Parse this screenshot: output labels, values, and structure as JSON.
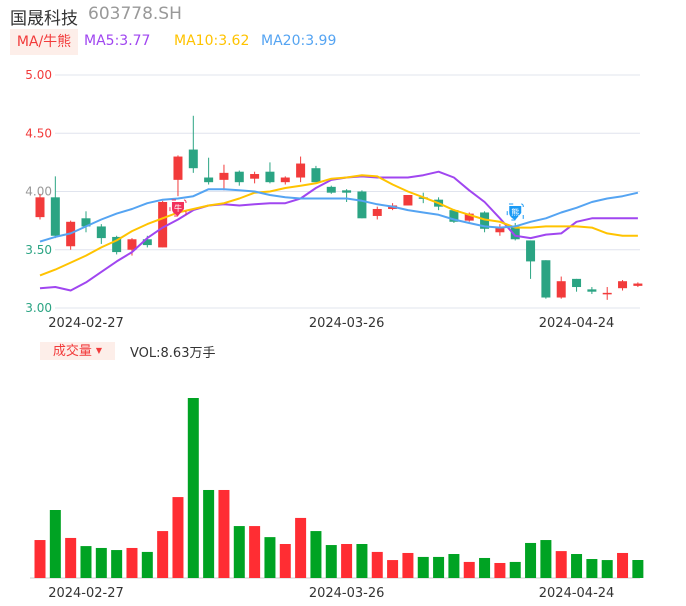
{
  "header": {
    "name": "国晟科技",
    "code": "603778.SH"
  },
  "ma_legend": {
    "tag": "MA/牛熊",
    "ma5": "MA5:3.77",
    "ma10": "MA10:3.62",
    "ma20": "MA20:3.99"
  },
  "volume_legend": {
    "tag": "成交量",
    "arrow": "▼",
    "value": "VOL:8.63万手"
  },
  "markers": {
    "bull": "牛",
    "bear": "熊"
  },
  "colors": {
    "up": "#f23b3b",
    "down": "#2ba483",
    "vol_up": "#ff2d33",
    "vol_down": "#00a323",
    "ma5": "#a046f0",
    "ma10": "#ffc300",
    "ma20": "#55a4f2"
  },
  "chart_data": [
    {
      "type": "candlestick",
      "title": "国晟科技 603778.SH",
      "yticks": [
        "5.00",
        "4.50",
        "4.00",
        "3.50",
        "3.00"
      ],
      "ylim": [
        3.0,
        5.0
      ],
      "xlabels": [
        {
          "index": 3,
          "label": "2024-02-27"
        },
        {
          "index": 20,
          "label": "2024-03-26"
        },
        {
          "index": 35,
          "label": "2024-04-24"
        }
      ],
      "ohlc": [
        [
          3.78,
          3.98,
          3.76,
          3.95
        ],
        [
          3.95,
          4.13,
          3.6,
          3.62
        ],
        [
          3.53,
          3.75,
          3.5,
          3.74
        ],
        [
          3.77,
          3.83,
          3.65,
          3.7
        ],
        [
          3.7,
          3.72,
          3.55,
          3.6
        ],
        [
          3.61,
          3.62,
          3.46,
          3.48
        ],
        [
          3.5,
          3.6,
          3.45,
          3.59
        ],
        [
          3.59,
          3.62,
          3.52,
          3.54
        ],
        [
          3.52,
          3.92,
          3.52,
          3.91
        ],
        [
          4.1,
          4.31,
          3.96,
          4.3
        ],
        [
          4.36,
          4.65,
          4.16,
          4.2
        ],
        [
          4.12,
          4.29,
          4.06,
          4.08
        ],
        [
          4.1,
          4.23,
          4.01,
          4.16
        ],
        [
          4.17,
          4.18,
          4.05,
          4.08
        ],
        [
          4.11,
          4.17,
          4.07,
          4.15
        ],
        [
          4.17,
          4.25,
          4.07,
          4.08
        ],
        [
          4.08,
          4.13,
          4.06,
          4.12
        ],
        [
          4.12,
          4.3,
          4.08,
          4.24
        ],
        [
          4.2,
          4.22,
          4.08,
          4.08
        ],
        [
          4.04,
          4.05,
          3.98,
          3.99
        ],
        [
          4.01,
          4.02,
          3.91,
          3.99
        ],
        [
          4.0,
          4.01,
          3.77,
          3.77
        ],
        [
          3.79,
          3.87,
          3.76,
          3.85
        ],
        [
          3.85,
          3.9,
          3.84,
          3.88
        ],
        [
          3.88,
          3.97,
          3.88,
          3.97
        ],
        [
          3.95,
          3.99,
          3.9,
          3.94
        ],
        [
          3.93,
          3.95,
          3.84,
          3.87
        ],
        [
          3.84,
          3.85,
          3.73,
          3.74
        ],
        [
          3.75,
          3.82,
          3.74,
          3.81
        ],
        [
          3.82,
          3.83,
          3.65,
          3.68
        ],
        [
          3.65,
          3.72,
          3.62,
          3.69
        ],
        [
          3.7,
          3.73,
          3.58,
          3.59
        ],
        [
          3.58,
          3.58,
          3.25,
          3.4
        ],
        [
          3.41,
          3.41,
          3.08,
          3.09
        ],
        [
          3.09,
          3.27,
          3.08,
          3.23
        ],
        [
          3.25,
          3.25,
          3.14,
          3.18
        ],
        [
          3.16,
          3.18,
          3.12,
          3.14
        ],
        [
          3.12,
          3.18,
          3.07,
          3.13
        ],
        [
          3.17,
          3.24,
          3.15,
          3.23
        ],
        [
          3.19,
          3.22,
          3.18,
          3.21
        ]
      ],
      "series": [
        {
          "name": "MA5",
          "values": [
            3.17,
            3.18,
            3.15,
            3.22,
            3.31,
            3.4,
            3.48,
            3.6,
            3.69,
            3.76,
            3.84,
            3.88,
            3.89,
            3.88,
            3.89,
            3.9,
            3.9,
            3.94,
            4.03,
            4.1,
            4.12,
            4.13,
            4.12,
            4.12,
            4.12,
            4.14,
            4.17,
            4.12,
            4.01,
            3.91,
            3.77,
            3.62,
            3.6,
            3.63,
            3.64,
            3.74,
            3.77,
            3.77,
            3.77,
            3.77
          ]
        },
        {
          "name": "MA10",
          "values": [
            3.28,
            3.33,
            3.39,
            3.45,
            3.52,
            3.58,
            3.66,
            3.72,
            3.77,
            3.82,
            3.85,
            3.88,
            3.9,
            3.94,
            3.99,
            4.0,
            4.03,
            4.05,
            4.07,
            4.11,
            4.12,
            4.14,
            4.13,
            4.06,
            4.0,
            3.95,
            3.9,
            3.84,
            3.8,
            3.76,
            3.74,
            3.69,
            3.69,
            3.7,
            3.7,
            3.7,
            3.69,
            3.64,
            3.62,
            3.62
          ]
        },
        {
          "name": "MA20",
          "values": [
            3.57,
            3.61,
            3.64,
            3.7,
            3.76,
            3.81,
            3.85,
            3.9,
            3.93,
            3.94,
            3.96,
            4.02,
            4.02,
            4.01,
            4.0,
            3.97,
            3.95,
            3.94,
            3.94,
            3.94,
            3.94,
            3.92,
            3.89,
            3.87,
            3.84,
            3.82,
            3.8,
            3.76,
            3.73,
            3.7,
            3.69,
            3.7,
            3.74,
            3.77,
            3.82,
            3.86,
            3.91,
            3.94,
            3.96,
            3.99
          ]
        }
      ],
      "signals": [
        {
          "index": 9,
          "type": "bull"
        },
        {
          "index": 31,
          "type": "bear"
        }
      ]
    },
    {
      "type": "bar",
      "title": "成交量",
      "unit": "万手",
      "xlabels": [
        {
          "index": 3,
          "label": "2024-02-27"
        },
        {
          "index": 20,
          "label": "2024-03-26"
        },
        {
          "index": 35,
          "label": "2024-04-24"
        }
      ],
      "values": [
        18.2,
        32.6,
        19.2,
        15.3,
        14.4,
        13.4,
        14.4,
        12.5,
        22.5,
        38.8,
        86.3,
        42.2,
        42.2,
        24.9,
        24.9,
        19.6,
        16.3,
        28.8,
        22.5,
        15.8,
        16.3,
        16.3,
        12.5,
        8.6,
        12.0,
        10.1,
        10.1,
        11.5,
        7.7,
        9.6,
        7.2,
        7.7,
        16.8,
        18.2,
        12.9,
        11.5,
        9.1,
        8.6,
        12.0,
        8.63
      ],
      "direction": [
        "up",
        "down",
        "up",
        "down",
        "down",
        "down",
        "up",
        "down",
        "up",
        "up",
        "down",
        "down",
        "up",
        "down",
        "up",
        "down",
        "up",
        "up",
        "down",
        "down",
        "up",
        "down",
        "up",
        "up",
        "up",
        "down",
        "down",
        "down",
        "up",
        "down",
        "up",
        "down",
        "down",
        "down",
        "up",
        "down",
        "down",
        "down",
        "up",
        "down"
      ]
    }
  ]
}
